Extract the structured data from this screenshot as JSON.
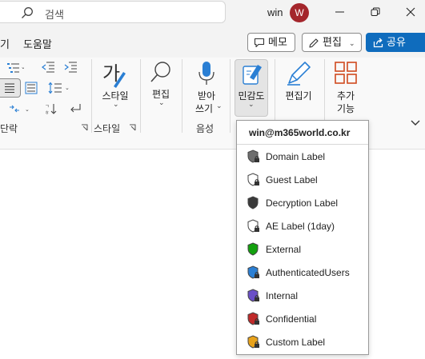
{
  "titlebar": {
    "search_placeholder": "검색",
    "user_name": "win",
    "avatar_initial": "W"
  },
  "menu": {
    "tabs": [
      "기",
      "도움말"
    ],
    "memo_label": "메모",
    "edit_label": "편집",
    "share_label": "공유"
  },
  "ribbon": {
    "paragraph_group_label": "단락",
    "style_button_label": "스타일",
    "style_group_label": "스타일",
    "editing_button_label": "편집",
    "dictate_button_label_1": "받아",
    "dictate_button_label_2": "쓰기",
    "voice_group_label": "음성",
    "sensitivity_button_label": "민감도",
    "editor_button_label": "편집기",
    "addins_button_label_1": "추가",
    "addins_button_label_2": "기능"
  },
  "sensitivity_menu": {
    "account": "win@m365world.co.kr",
    "items": [
      {
        "label": "Domain Label",
        "color": "#6e6e6e",
        "lock": true
      },
      {
        "label": "Guest Label",
        "color": "#ffffff",
        "lock": true
      },
      {
        "label": "Decryption Label",
        "color": "#3a3a3a",
        "lock": false
      },
      {
        "label": "AE Label (1day)",
        "color": "#ffffff",
        "lock": true
      },
      {
        "label": "External",
        "color": "#13a10e",
        "lock": false
      },
      {
        "label": "AuthenticatedUsers",
        "color": "#2a7fd4",
        "lock": true
      },
      {
        "label": "Internal",
        "color": "#6a4fc8",
        "lock": true
      },
      {
        "label": "Confidential",
        "color": "#c02a2a",
        "lock": true
      },
      {
        "label": "Custom Label",
        "color": "#e8a21a",
        "lock": true
      }
    ]
  },
  "colors": {
    "accent": "#0f6cbd",
    "avatar_bg": "#a4262c"
  }
}
